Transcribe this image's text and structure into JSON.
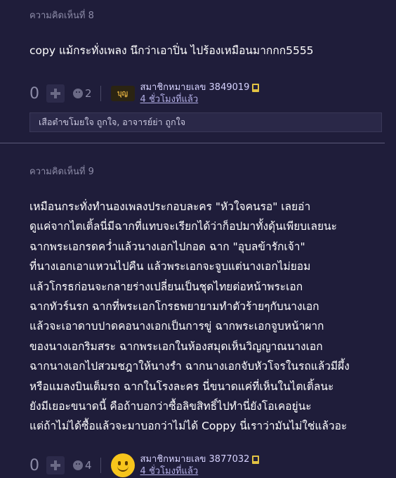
{
  "comments": [
    {
      "label": "ความคิดเห็นที่ 8",
      "body": [
        "copy แม้กระทั่งเพลง นึกว่าเอาปิ่น ไปร้องเหมือนมากกก5555"
      ],
      "votes": "0",
      "emoji_count": "2",
      "author": "สมาชิกหมายเลข 3849019",
      "time": "4 ชั่วโมงที่แล้ว",
      "avatar_text": "บุญ",
      "reply": "เสือตำขโมยใจ ถูกใจ, อาจารย์ย่า ถูกใจ"
    },
    {
      "label": "ความคิดเห็นที่ 9",
      "body": [
        "เหมือนกระทั่งทำนองเพลงประกอบละคร \"หัวใจคนรอ\" เลยอ่า",
        "ดูแค่จากไตเติ้ลนี่มีฉากที่แทบจะเรียกได้ว่าก็อปมาทั้งดุ้นเพียบเลยนะ",
        "ฉากพระเอกรดคว่ำแล้วนางเอกไปกอด ฉาก \"อุบลข้ารักเจ้า\"",
        "ที่นางเอกเอาแหวนไปคืน แล้วพระเอกจะจูบแต่นางเอกไม่ยอม",
        "แล้วโกรธก่อนจะกลายร่างเปลี่ยนเป็นชุดไทยต่อหน้าพระเอก",
        "ฉากทัวร์นรก ฉากที่พระเอกโกรธพยายามทำตัวร้ายๆกับนางเอก",
        "แล้วจะเอาดาบปาดคอนางเอกเป็นการขู่ ฉากพระเอกจูบหน้าผาก",
        "ของนางเอกริมสระ ฉากพระเอกในห้องสมุดเห็นวิญญาณนางเอก",
        "ฉากนางเอกไปสวมชฎาให้นางรำ ฉากนางเอกจับหัวโจรในรถแล้วมีผึ้ง",
        "หรือแมลงบินเต็มรถ ฉากในโรงละคร นี่ขนาดแค่ที่เห็นในไตเติ้ลนะ",
        "ยังมีเยอะขนาดนี้ คือถ้าบอกว่าซื้อลิขสิทธิ์ไปทำนี่ยังโอเคอยู่นะ",
        "แต่ถ้าไม่ได้ซื้อแล้วจะมาบอกว่าไม่ได้ Coppy นี่เราว่ามันไม่ใช่แล้วอะ"
      ],
      "votes": "0",
      "emoji_count": "4",
      "author": "สมาชิกหมายเลข 3877032",
      "time": "4 ชั่วโมงที่แล้ว"
    }
  ],
  "icons": {
    "plus": "plus-icon",
    "emoji": "emoji-icon",
    "phone": "mobile-phone-icon"
  },
  "colors": {
    "background": "#1f1d3a",
    "muted": "#8d8ca8",
    "author": "#d7d3ff",
    "badge": "#e1c243"
  }
}
